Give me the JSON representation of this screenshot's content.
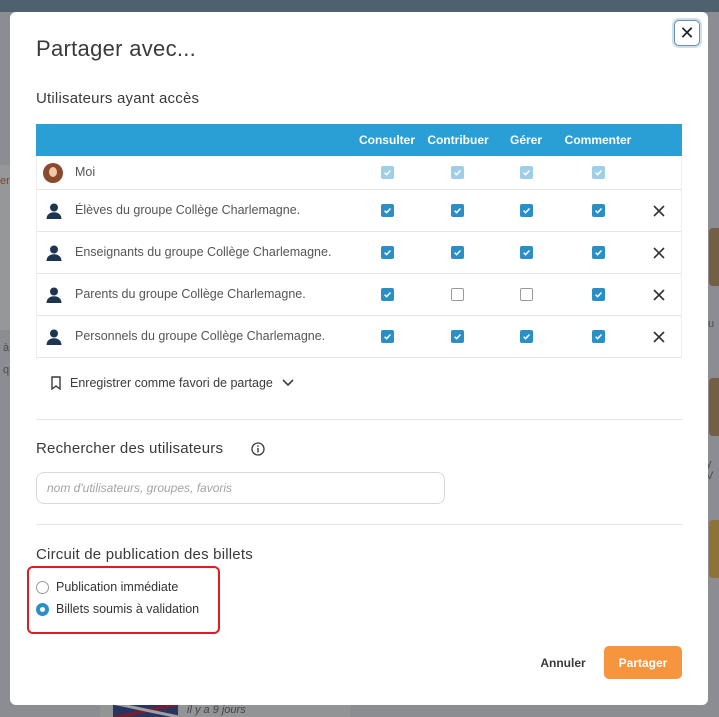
{
  "background": {
    "left_card_text": "er",
    "left_text_1": "à",
    "left_text_2": "q",
    "right_text_1": "u",
    "right_text_2": "y V",
    "bottom_time_ago": "il y a 9 jours"
  },
  "modal": {
    "title": "Partager avec...",
    "close_label": "✕",
    "users_section": {
      "title": "Utilisateurs ayant accès",
      "columns": [
        "Consulter",
        "Contribuer",
        "Gérer",
        "Commenter"
      ],
      "rows": [
        {
          "label": "Moi",
          "type": "self",
          "rights": [
            "disabled",
            "disabled",
            "disabled",
            "disabled"
          ],
          "removable": false
        },
        {
          "label": "Élèves du groupe Collège Charlemagne.",
          "type": "group",
          "rights": [
            "on",
            "on",
            "on",
            "on"
          ],
          "removable": true
        },
        {
          "label": "Enseignants du groupe Collège Charlemagne.",
          "type": "group",
          "rights": [
            "on",
            "on",
            "on",
            "on"
          ],
          "removable": true
        },
        {
          "label": "Parents du groupe Collège Charlemagne.",
          "type": "group",
          "rights": [
            "on",
            "off",
            "off",
            "on"
          ],
          "removable": true
        },
        {
          "label": "Personnels du groupe Collège Charlemagne.",
          "type": "group",
          "rights": [
            "on",
            "on",
            "on",
            "on"
          ],
          "removable": true
        }
      ]
    },
    "favorite": {
      "label": "Enregistrer comme favori de partage"
    },
    "search_section": {
      "title": "Rechercher des utilisateurs",
      "placeholder": "nom d'utilisateurs, groupes, favoris",
      "value": ""
    },
    "publication_section": {
      "title": "Circuit de publication des billets",
      "options": [
        {
          "label": "Publication immédiate",
          "selected": false
        },
        {
          "label": "Billets soumis à validation",
          "selected": true
        }
      ]
    },
    "buttons": {
      "cancel": "Annuler",
      "share": "Partager"
    }
  },
  "colors": {
    "header_blue": "#2a9fd6",
    "checkbox_blue": "#2a8fc4",
    "share_orange": "#f7943e",
    "highlight_red": "#e01b24"
  }
}
